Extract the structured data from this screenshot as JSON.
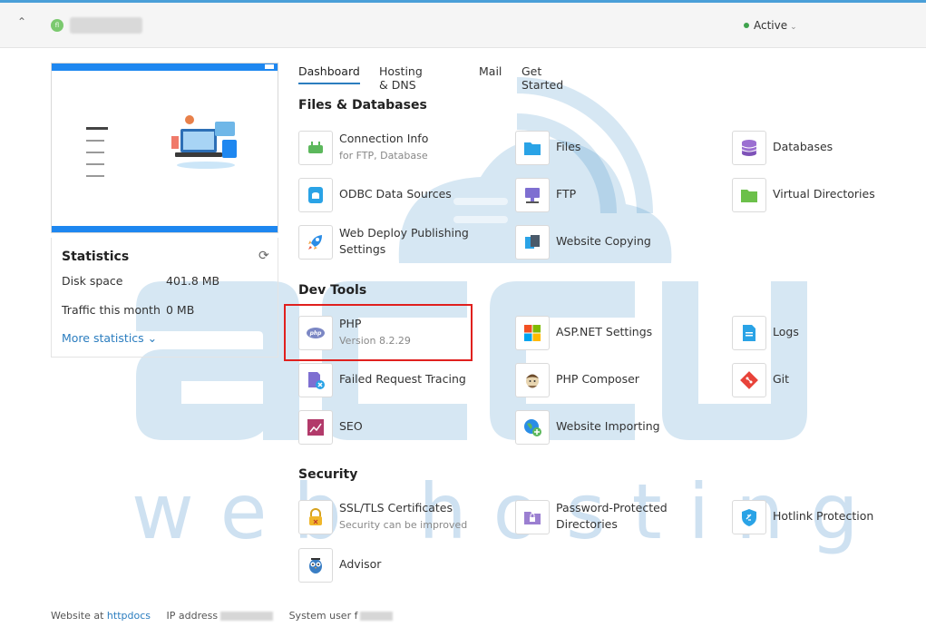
{
  "header": {
    "collapse_icon": "chevron-up-icon",
    "site_avatar": "fl",
    "status": "Active"
  },
  "tabs": [
    {
      "label": "Dashboard",
      "active": true
    },
    {
      "label": "Hosting & DNS",
      "active": false
    },
    {
      "label": "Mail",
      "active": false
    },
    {
      "label": "Get Started",
      "active": false
    }
  ],
  "statistics": {
    "title": "Statistics",
    "disk_label": "Disk space",
    "disk_value": "401.8 MB",
    "traffic_label": "Traffic this month",
    "traffic_value": "0 MB",
    "more": "More statistics"
  },
  "sections": {
    "files": "Files & Databases",
    "dev": "Dev Tools",
    "security": "Security"
  },
  "tools": {
    "connection_info": {
      "label": "Connection Info",
      "sub": "for FTP, Database"
    },
    "files": {
      "label": "Files"
    },
    "databases": {
      "label": "Databases"
    },
    "odbc": {
      "label": "ODBC Data Sources"
    },
    "ftp": {
      "label": "FTP"
    },
    "virtual_dirs": {
      "label": "Virtual Directories"
    },
    "web_deploy": {
      "label": "Web Deploy Publishing",
      "label2": "Settings"
    },
    "website_copying": {
      "label": "Website Copying"
    },
    "php": {
      "label": "PHP",
      "sub": "Version 8.2.29"
    },
    "aspnet": {
      "label": "ASP.NET Settings"
    },
    "logs": {
      "label": "Logs"
    },
    "failed_request": {
      "label": "Failed Request Tracing"
    },
    "php_composer": {
      "label": "PHP Composer"
    },
    "git": {
      "label": "Git"
    },
    "seo": {
      "label": "SEO"
    },
    "website_importing": {
      "label": "Website Importing"
    },
    "ssl": {
      "label": "SSL/TLS Certificates",
      "sub": "Security can be improved"
    },
    "password_dirs": {
      "label": "Password-Protected",
      "label2": "Directories"
    },
    "hotlink": {
      "label": "Hotlink Protection"
    },
    "advisor": {
      "label": "Advisor"
    }
  },
  "watermark": {
    "text": "web hosting"
  },
  "footer": {
    "website_prefix": "Website at",
    "website_link": "httpdocs",
    "ip_label": "IP address",
    "user_label": "System user",
    "user_prefix": "f"
  },
  "colors": {
    "accent": "#2b7dbf",
    "highlight": "#e0201e",
    "active": "#3fa34d"
  }
}
